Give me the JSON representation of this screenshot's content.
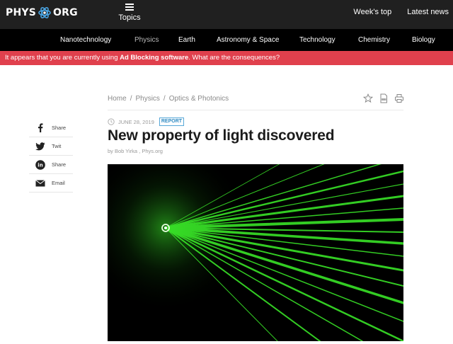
{
  "header": {
    "logo_left": "PHYS",
    "logo_right": "ORG",
    "topics_label": "Topics",
    "links": [
      "Week's top",
      "Latest news"
    ]
  },
  "nav": {
    "items": [
      {
        "label": "Nanotechnology",
        "active": false
      },
      {
        "label": "Physics",
        "active": true
      },
      {
        "label": "Earth",
        "active": false
      },
      {
        "label": "Astronomy & Space",
        "active": false
      },
      {
        "label": "Technology",
        "active": false
      },
      {
        "label": "Chemistry",
        "active": false
      },
      {
        "label": "Biology",
        "active": false
      }
    ]
  },
  "adblock": {
    "prefix": "It appears that you are currently using ",
    "highlight": "Ad Blocking software",
    "suffix": ". What are the consequences?",
    "color": "#e0404d"
  },
  "breadcrumb": [
    "Home",
    "Physics",
    "Optics & Photonics"
  ],
  "breadcrumb_separator": "/",
  "article": {
    "date": "JUNE 28, 2019",
    "badge": "REPORT",
    "title": "New property of light discovered",
    "byline": "by Bob Yirka , Phys.org",
    "image_icon": "green-laser-beams-image"
  },
  "share": {
    "items": [
      {
        "label": "Share",
        "icon": "facebook-icon"
      },
      {
        "label": "Twit",
        "icon": "twitter-icon"
      },
      {
        "label": "Share",
        "icon": "linkedin-icon"
      },
      {
        "label": "Email",
        "icon": "email-icon"
      }
    ]
  },
  "colors": {
    "accent": "#2f8ac2",
    "header_bg": "#202020",
    "nav_bg": "#000000",
    "laser": "#3cf02a"
  }
}
